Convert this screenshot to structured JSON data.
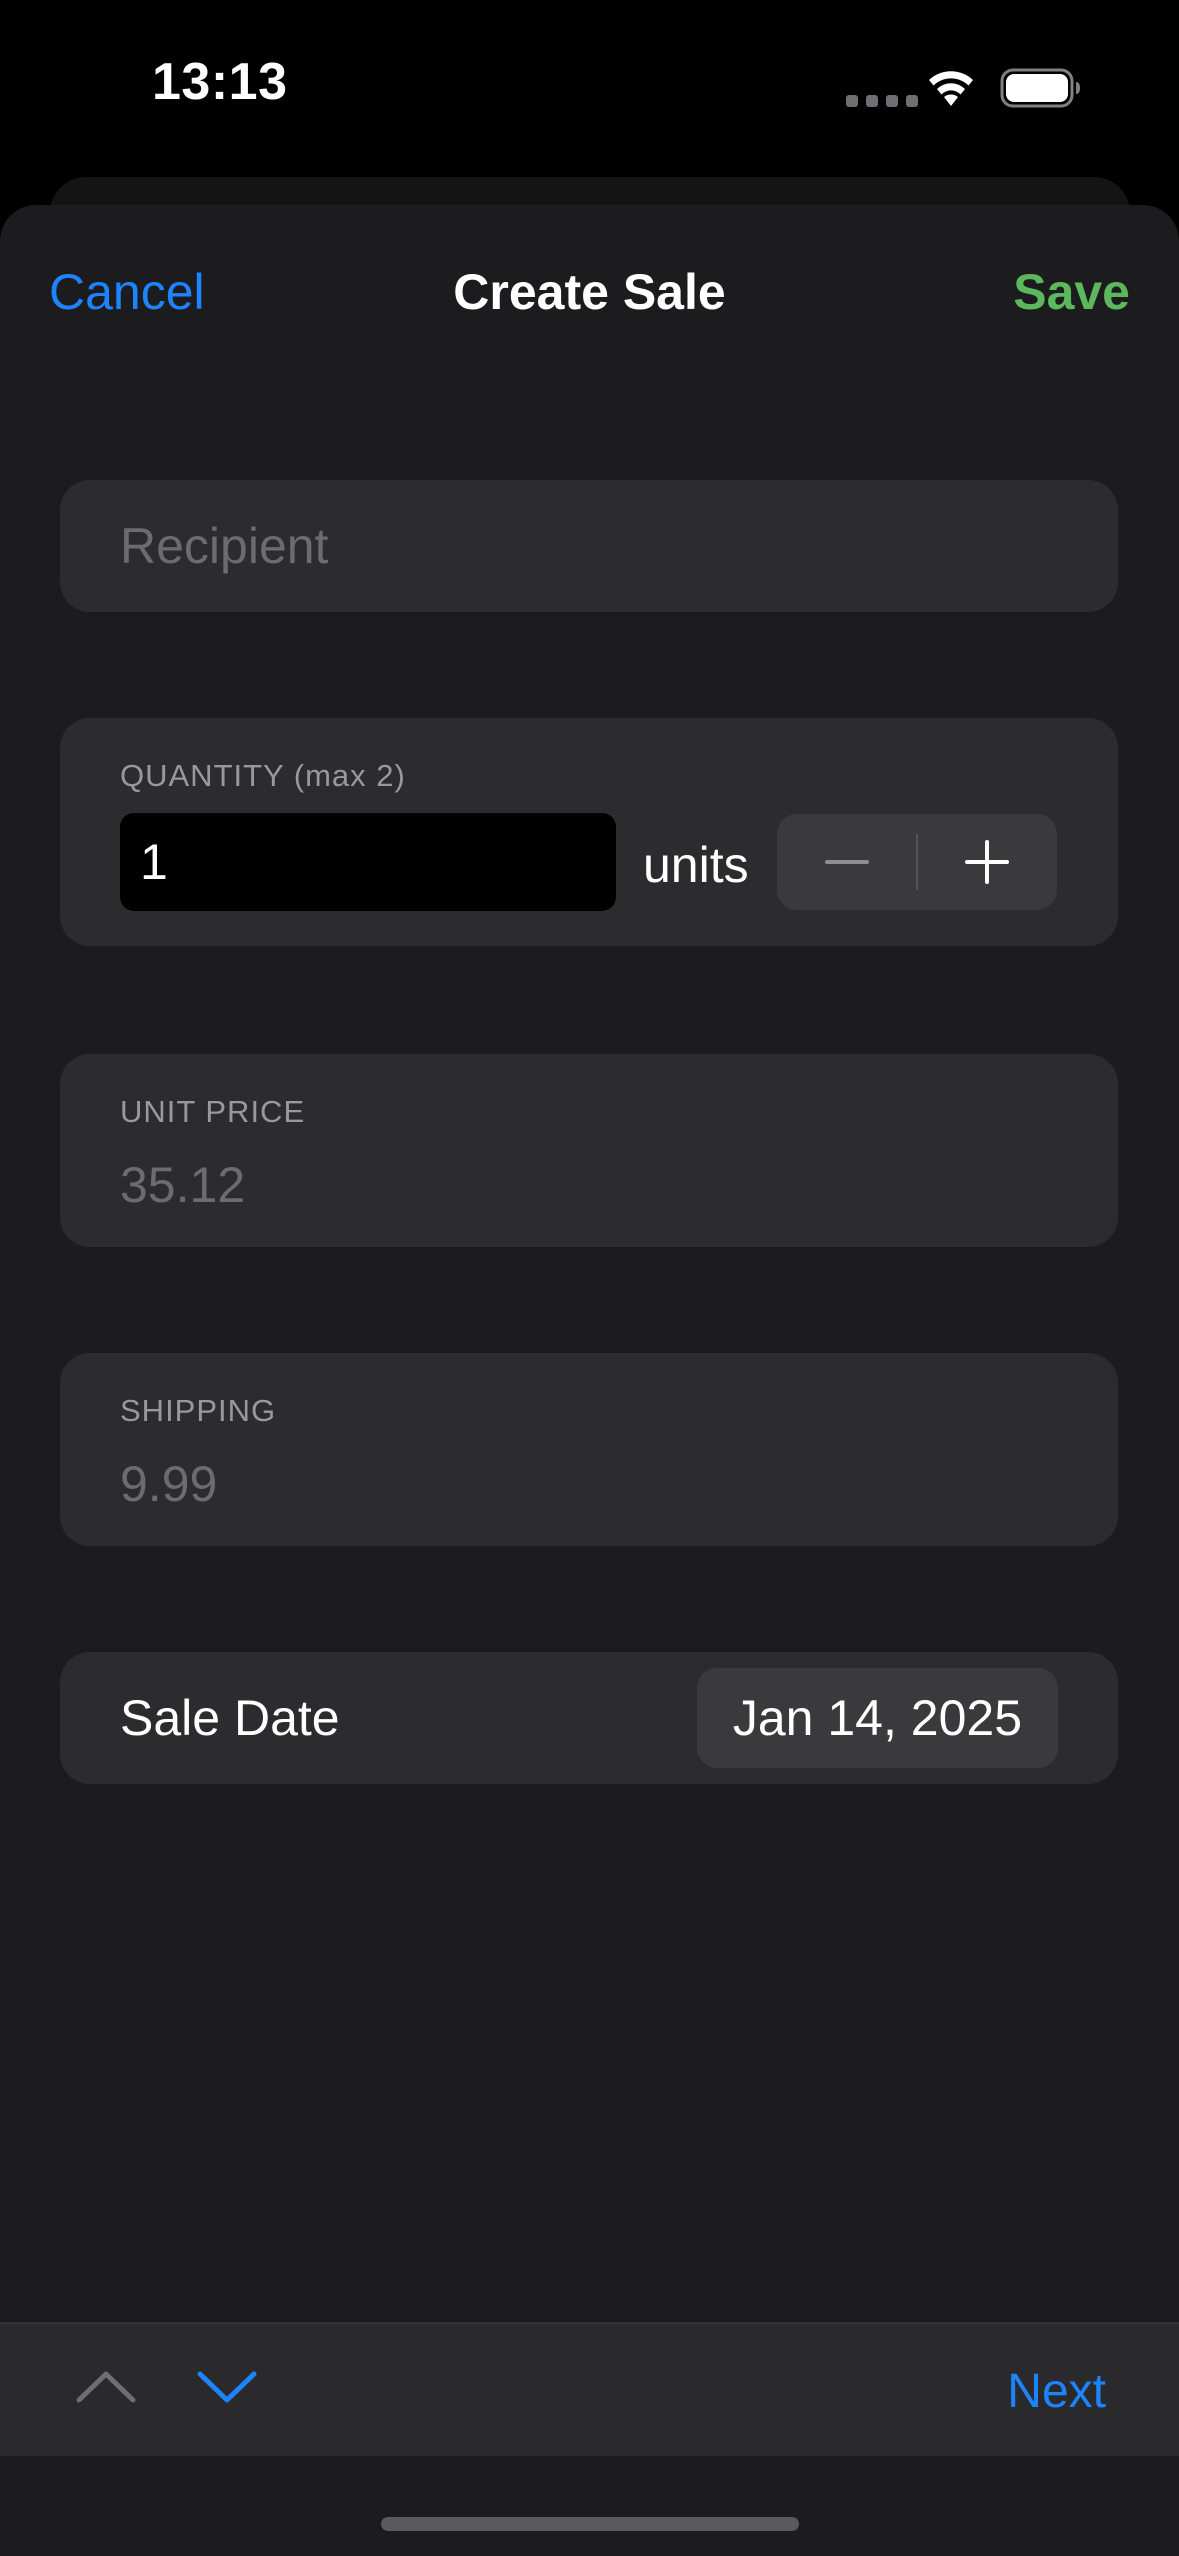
{
  "status_bar": {
    "time": "13:13"
  },
  "nav": {
    "cancel_label": "Cancel",
    "title": "Create Sale",
    "save_label": "Save"
  },
  "form": {
    "recipient": {
      "placeholder": "Recipient",
      "value": ""
    },
    "quantity": {
      "label": "QUANTITY (max 2)",
      "value": "1",
      "units_label": "units"
    },
    "unit_price": {
      "label": "UNIT PRICE",
      "value": "35.12"
    },
    "shipping": {
      "label": "SHIPPING",
      "value": "9.99"
    },
    "sale_date": {
      "label": "Sale Date",
      "value": "Jan 14, 2025"
    }
  },
  "accessory_bar": {
    "next_label": "Next"
  },
  "icons": {
    "wifi": "wifi-icon",
    "battery": "battery-icon",
    "minus": "minus-icon",
    "plus": "plus-icon",
    "chevron_up": "chevron-up-icon",
    "chevron_down": "chevron-down-icon"
  },
  "colors": {
    "accent_blue": "#1d84ff",
    "save_green": "#5cb85c",
    "sheet_background": "#1c1c1e",
    "card_background": "#2c2c2e"
  }
}
